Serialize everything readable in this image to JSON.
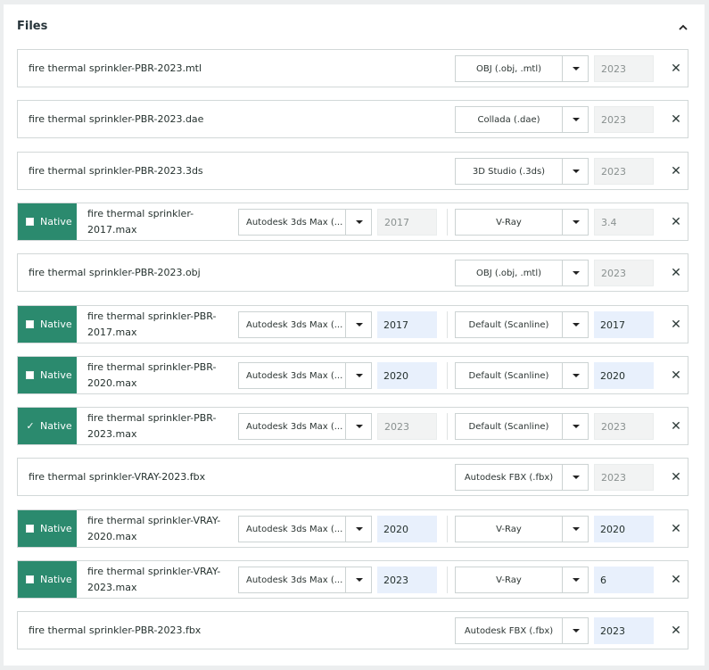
{
  "header": {
    "title": "Files",
    "collapse_icon": "chevron-up-icon"
  },
  "rows": [
    {
      "type": "simple",
      "file": "fire thermal sprinkler-PBR-2023.mtl",
      "format": "OBJ (.obj, .mtl)",
      "version": "2023",
      "version_active": false
    },
    {
      "type": "simple",
      "file": "fire thermal sprinkler-PBR-2023.dae",
      "format": "Collada (.dae)",
      "version": "2023",
      "version_active": false
    },
    {
      "type": "simple",
      "file": "fire thermal sprinkler-PBR-2023.3ds",
      "format": "3D Studio (.3ds)",
      "version": "2023",
      "version_active": false
    },
    {
      "type": "native",
      "native_label": "Native",
      "checked": false,
      "file": "fire thermal sprinkler-2017.max",
      "app": "Autodesk 3ds Max (...",
      "app_version": "2017",
      "app_version_active": false,
      "renderer": "V-Ray",
      "renderer_version": "3.4",
      "renderer_version_active": false
    },
    {
      "type": "simple",
      "file": "fire thermal sprinkler-PBR-2023.obj",
      "format": "OBJ (.obj, .mtl)",
      "version": "2023",
      "version_active": false
    },
    {
      "type": "native",
      "native_label": "Native",
      "checked": false,
      "file": "fire thermal sprinkler-PBR-2017.max",
      "app": "Autodesk 3ds Max (...",
      "app_version": "2017",
      "app_version_active": true,
      "renderer": "Default (Scanline)",
      "renderer_version": "2017",
      "renderer_version_active": true
    },
    {
      "type": "native",
      "native_label": "Native",
      "checked": false,
      "file": "fire thermal sprinkler-PBR-2020.max",
      "app": "Autodesk 3ds Max (...",
      "app_version": "2020",
      "app_version_active": true,
      "renderer": "Default (Scanline)",
      "renderer_version": "2020",
      "renderer_version_active": true
    },
    {
      "type": "native",
      "native_label": "Native",
      "checked": true,
      "file": "fire thermal sprinkler-PBR-2023.max",
      "app": "Autodesk 3ds Max (...",
      "app_version": "2023",
      "app_version_active": false,
      "renderer": "Default (Scanline)",
      "renderer_version": "2023",
      "renderer_version_active": false
    },
    {
      "type": "simple",
      "file": "fire thermal sprinkler-VRAY-2023.fbx",
      "format": "Autodesk FBX (.fbx)",
      "version": "2023",
      "version_active": false
    },
    {
      "type": "native",
      "native_label": "Native",
      "checked": false,
      "file": "fire thermal sprinkler-VRAY-2020.max",
      "app": "Autodesk 3ds Max (...",
      "app_version": "2020",
      "app_version_active": true,
      "renderer": "V-Ray",
      "renderer_version": "2020",
      "renderer_version_active": true
    },
    {
      "type": "native",
      "native_label": "Native",
      "checked": false,
      "file": "fire thermal sprinkler-VRAY-2023.max",
      "app": "Autodesk 3ds Max (...",
      "app_version": "2023",
      "app_version_active": true,
      "renderer": "V-Ray",
      "renderer_version": "6",
      "renderer_version_active": true
    },
    {
      "type": "simple",
      "file": "fire thermal sprinkler-PBR-2023.fbx",
      "format": "Autodesk FBX (.fbx)",
      "version": "2023",
      "version_active": true
    }
  ],
  "colors": {
    "native_bg": "#2b8a6e",
    "active_input_bg": "#e8f0fc",
    "disabled_input_bg": "#f2f3f3"
  },
  "icons": {
    "dropdown": "caret-down-icon",
    "remove": "close-icon",
    "checkbox": "checkbox-icon",
    "check": "checkmark-icon"
  }
}
